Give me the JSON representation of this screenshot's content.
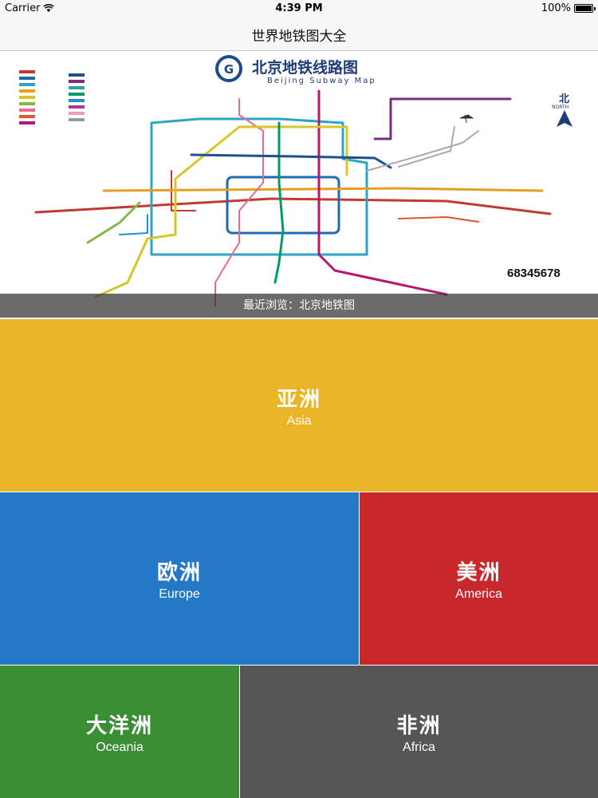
{
  "status_bar": {
    "carrier": "Carrier",
    "time": "4:39 PM",
    "battery": "100%",
    "battery_level": 1.0
  },
  "nav": {
    "title": "世界地铁图大全"
  },
  "banner": {
    "map_title_cn": "北京地铁线路图",
    "map_title_en": "Beijing Subway Map",
    "north_label": "北",
    "north_en": "NORTH",
    "hotline_number": "68345678",
    "recent_label": "最近浏览：北京地铁图"
  },
  "colors": {
    "asia": "#eab427",
    "europe": "#2578c6",
    "america": "#c8282b",
    "oceania": "#3a8e34",
    "africa": "#565656"
  },
  "continents": {
    "asia": {
      "cn": "亚洲",
      "en": "Asia"
    },
    "europe": {
      "cn": "欧洲",
      "en": "Europe"
    },
    "america": {
      "cn": "美洲",
      "en": "America"
    },
    "oceania": {
      "cn": "大洋洲",
      "en": "Oceania"
    },
    "africa": {
      "cn": "非洲",
      "en": "Africa"
    }
  }
}
